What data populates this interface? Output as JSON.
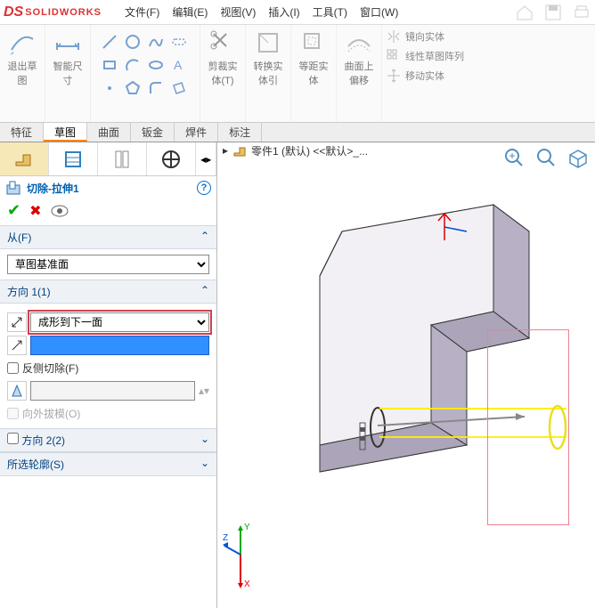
{
  "app": {
    "logo_ds": "DS",
    "logo_text": "SOLIDWORKS"
  },
  "menu": [
    "文件(F)",
    "编辑(E)",
    "视图(V)",
    "插入(I)",
    "工具(T)",
    "窗口(W)"
  ],
  "ribbon": {
    "exit_sketch": "退出草图",
    "smart_dim": "智能尺寸",
    "trim": "剪裁实体(T)",
    "convert": "转换实体引",
    "offset": "等距实体",
    "surface_offset": "曲面上偏移",
    "mirror": "镜向实体",
    "pattern": "线性草图阵列",
    "move": "移动实体"
  },
  "tabs": [
    "特征",
    "草图",
    "曲面",
    "钣金",
    "焊件",
    "标注"
  ],
  "active_tab": "草图",
  "feature": {
    "name": "切除-拉伸1",
    "from_label": "从(F)",
    "from_value": "草图基准面",
    "dir1_label": "方向 1(1)",
    "dir1_value": "成形到下一面",
    "flip_cut": "反侧切除(F)",
    "draft_out": "向外拔模(O)",
    "dir2_label": "方向 2(2)",
    "contours_label": "所选轮廓(S)"
  },
  "document": {
    "arrow": "▸",
    "name": "零件1 (默认) <<默认>_..."
  },
  "triad": {
    "x": "X",
    "y": "Y",
    "z": "Z"
  }
}
